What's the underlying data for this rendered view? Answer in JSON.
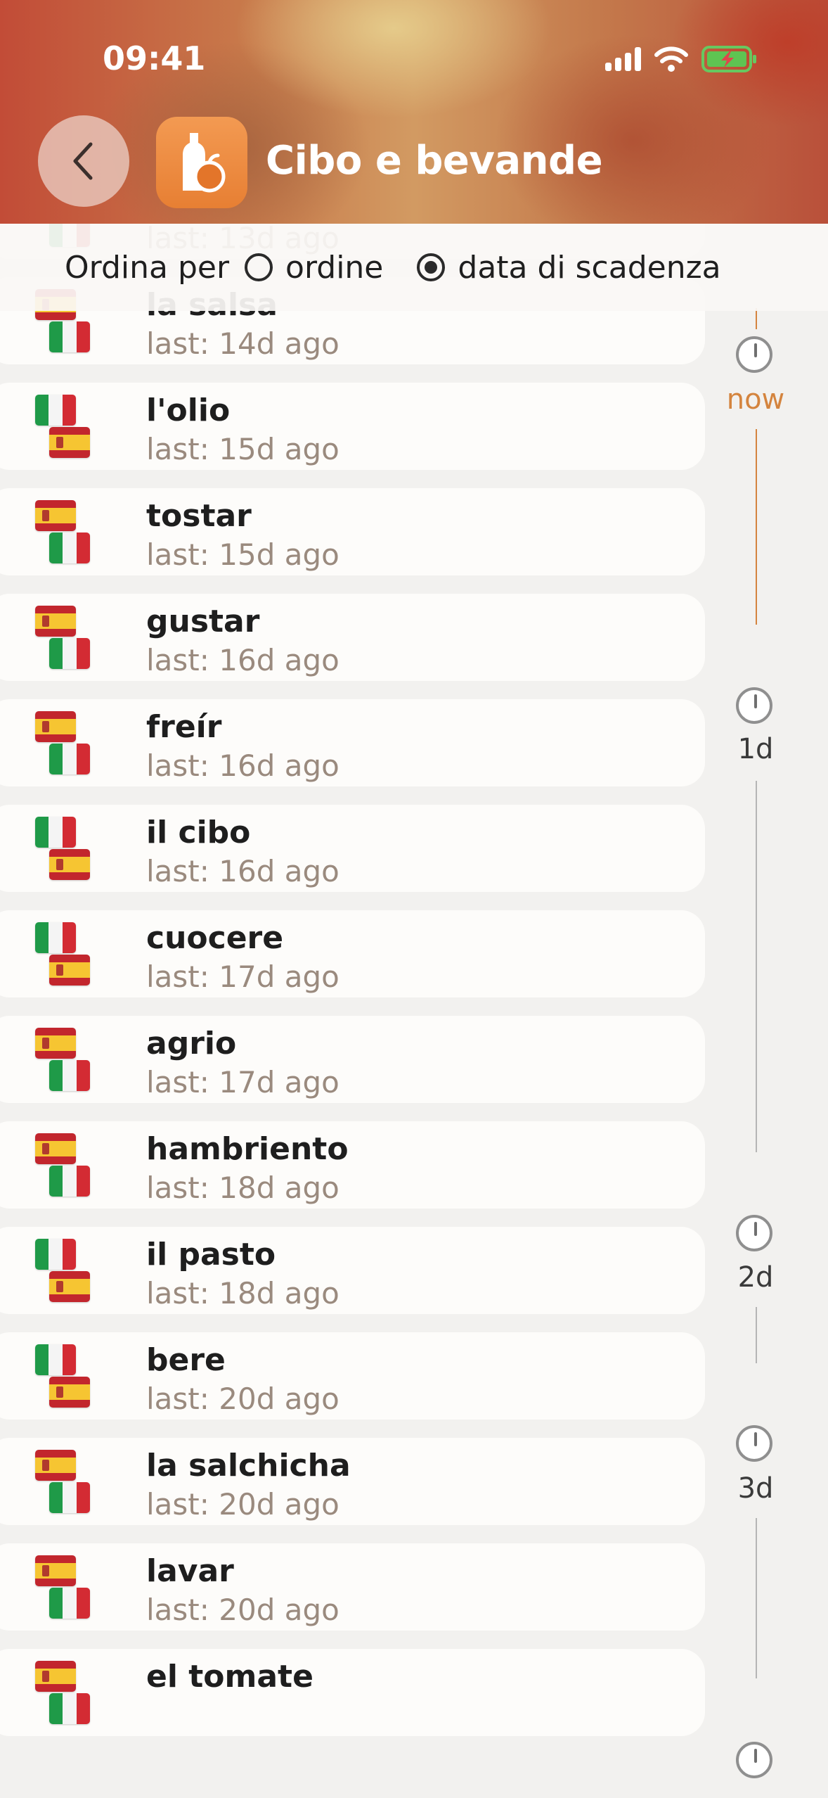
{
  "status": {
    "time": "09:41"
  },
  "header": {
    "title": "Cibo e bevande"
  },
  "sort": {
    "label": "Ordina per",
    "option_order": "ordine",
    "option_due": "data di scadenza",
    "selected": "data di scadenza"
  },
  "items": [
    {
      "word": "",
      "last": "last: 13d ago",
      "flags": "es-it"
    },
    {
      "word": "la salsa",
      "last": "last: 14d ago",
      "flags": "es-it"
    },
    {
      "word": "l'olio",
      "last": "last: 15d ago",
      "flags": "it-es"
    },
    {
      "word": "tostar",
      "last": "last: 15d ago",
      "flags": "es-it"
    },
    {
      "word": "gustar",
      "last": "last: 16d ago",
      "flags": "es-it"
    },
    {
      "word": "freír",
      "last": "last: 16d ago",
      "flags": "es-it"
    },
    {
      "word": "il cibo",
      "last": "last: 16d ago",
      "flags": "it-es"
    },
    {
      "word": "cuocere",
      "last": "last: 17d ago",
      "flags": "it-es"
    },
    {
      "word": "agrio",
      "last": "last: 17d ago",
      "flags": "es-it"
    },
    {
      "word": "hambriento",
      "last": "last: 18d ago",
      "flags": "es-it"
    },
    {
      "word": "il pasto",
      "last": "last: 18d ago",
      "flags": "it-es"
    },
    {
      "word": "bere",
      "last": "last: 20d ago",
      "flags": "it-es"
    },
    {
      "word": "la salchicha",
      "last": "last: 20d ago",
      "flags": "es-it"
    },
    {
      "word": "lavar",
      "last": "last: 20d ago",
      "flags": "es-it"
    },
    {
      "word": "el tomate",
      "last": "",
      "flags": "es-it"
    }
  ],
  "timeline": [
    {
      "label": "now",
      "color": "#d4843e"
    },
    {
      "label": "1d",
      "color": "#3a3a3a"
    },
    {
      "label": "2d",
      "color": "#3a3a3a"
    },
    {
      "label": "3d",
      "color": "#3a3a3a"
    },
    {
      "label": "",
      "color": "#3a3a3a"
    }
  ],
  "colors": {
    "accent": "#d4843e",
    "orange_icon": "#e98a3c",
    "line": "#b5b5b5"
  }
}
